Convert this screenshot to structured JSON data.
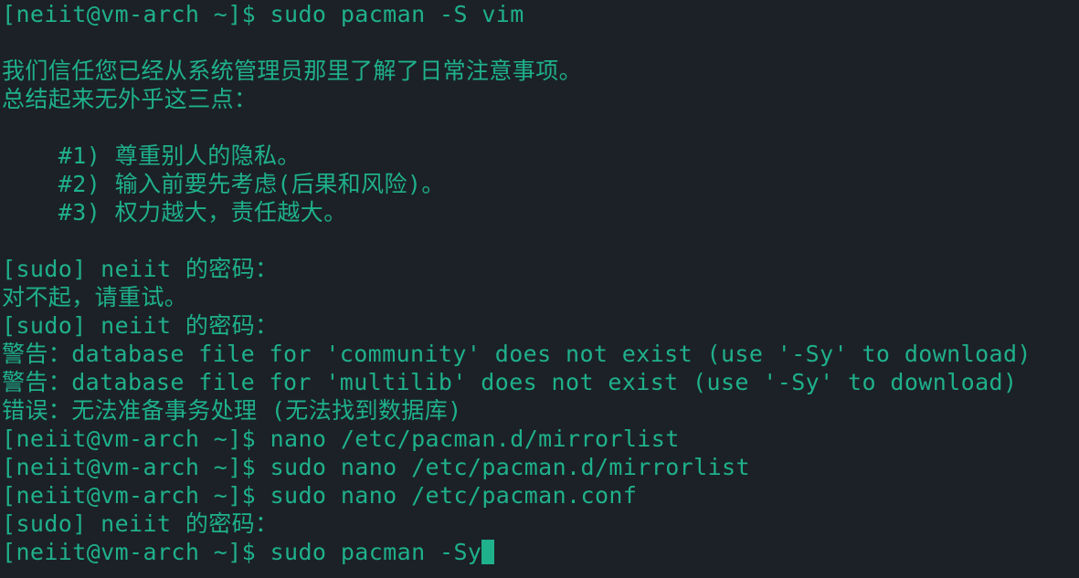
{
  "terminal": {
    "lines": [
      "[neiit@vm-arch ~]$ sudo pacman -S vim",
      "",
      "我们信任您已经从系统管理员那里了解了日常注意事项。",
      "总结起来无外乎这三点：",
      "",
      "    #1) 尊重别人的隐私。",
      "    #2) 输入前要先考虑(后果和风险)。",
      "    #3) 权力越大，责任越大。",
      "",
      "[sudo] neiit 的密码：",
      "对不起，请重试。",
      "[sudo] neiit 的密码：",
      "警告：database file for 'community' does not exist (use '-Sy' to download)",
      "警告：database file for 'multilib' does not exist (use '-Sy' to download)",
      "错误：无法准备事务处理 (无法找到数据库)",
      "[neiit@vm-arch ~]$ nano /etc/pacman.d/mirrorlist",
      "[neiit@vm-arch ~]$ sudo nano /etc/pacman.d/mirrorlist",
      "[neiit@vm-arch ~]$ sudo nano /etc/pacman.conf",
      "[sudo] neiit 的密码：",
      "[neiit@vm-arch ~]$ sudo pacman -Sy"
    ]
  },
  "colors": {
    "background": "#1c2127",
    "foreground": "#1fb08c"
  }
}
